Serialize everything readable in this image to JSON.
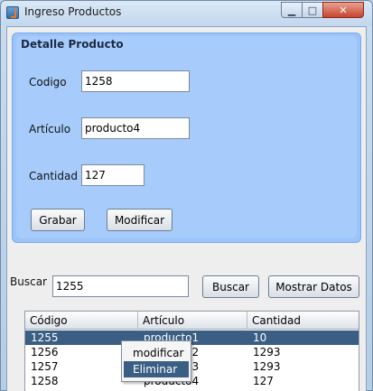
{
  "window": {
    "title": "Ingreso Productos",
    "min_glyph": "▁",
    "max_glyph": "□",
    "close_glyph": "✕"
  },
  "detail_panel": {
    "title": "Detalle Producto",
    "codigo_label": "Codigo",
    "codigo_value": "1258",
    "articulo_label": "Artículo",
    "articulo_value": "producto4",
    "cantidad_label": "Cantidad",
    "cantidad_value": "127",
    "grabar_label": "Grabar",
    "modificar_label": "Modificar"
  },
  "search": {
    "label": "Buscar",
    "value": "1255",
    "buscar_button": "Buscar",
    "mostrar_button": "Mostrar Datos"
  },
  "table": {
    "columns": [
      "Código",
      "Artículo",
      "Cantidad"
    ],
    "rows": [
      [
        "1255",
        "producto1",
        "10"
      ],
      [
        "1256",
        "producto2",
        "1293"
      ],
      [
        "1257",
        "producto3",
        "1293"
      ],
      [
        "1258",
        "producto4",
        "127"
      ]
    ],
    "selected_row": 0
  },
  "context_menu": {
    "items": [
      "modificar",
      "Eliminar"
    ],
    "active_index": 1
  },
  "colors": {
    "panel": "#99c4fc",
    "selection": "#3b5e84"
  }
}
